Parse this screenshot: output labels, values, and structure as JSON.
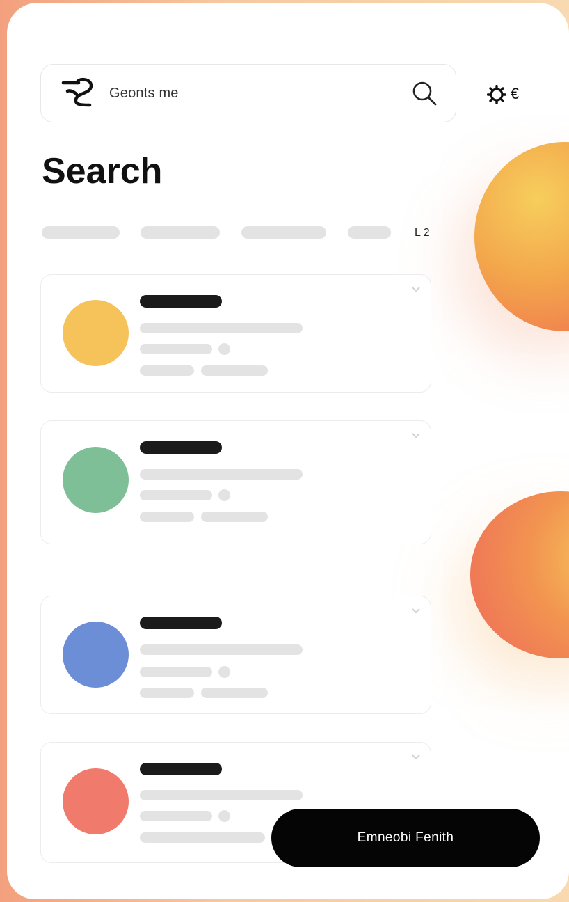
{
  "search": {
    "brand_icon": "brand-logo-icon",
    "value": "Geonts me",
    "search_icon": "search-icon"
  },
  "header": {
    "settings_icon": "gear-icon",
    "settings_glyph": "€"
  },
  "page": {
    "title": "Search"
  },
  "filters": {
    "count": "L 2"
  },
  "results": [
    {
      "avatar_color": "#f6c35a"
    },
    {
      "avatar_color": "#7fbf98"
    },
    {
      "avatar_color": "#6b8ed6"
    },
    {
      "avatar_color": "#f07a6b"
    }
  ],
  "action": {
    "label": "Emneobi Fenith"
  }
}
